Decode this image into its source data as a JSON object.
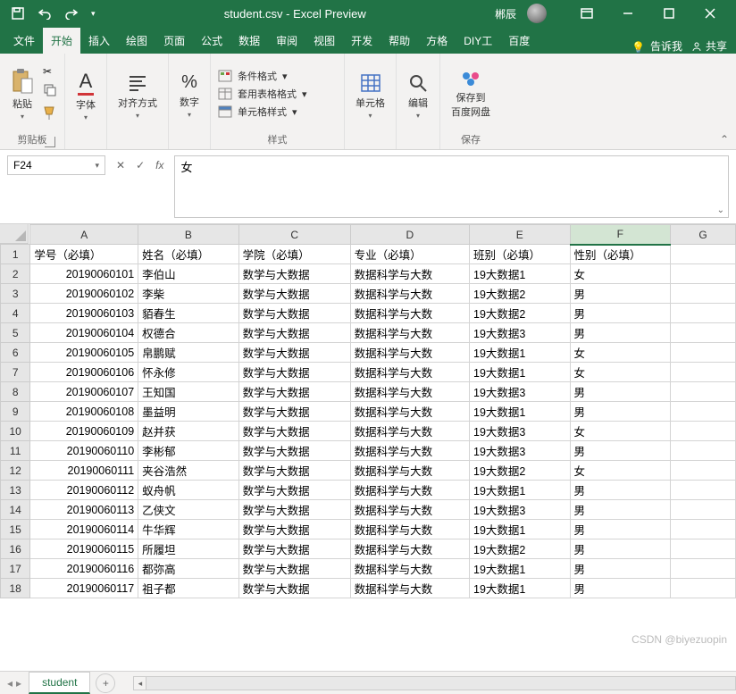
{
  "titlebar": {
    "filename": "student.csv",
    "app_suffix": " - Excel Preview",
    "username": "郴辰"
  },
  "tabs": {
    "file": "文件",
    "home": "开始",
    "insert": "插入",
    "draw": "绘图",
    "layout": "页面",
    "formulas": "公式",
    "data": "数据",
    "review": "审阅",
    "view": "视图",
    "dev": "开发",
    "help": "帮助",
    "fangge": "方格",
    "diy": "DIY工",
    "baidu": "百度",
    "tellme": "告诉我",
    "share": "共享"
  },
  "ribbon": {
    "clipboard": {
      "paste": "粘贴",
      "label": "剪贴板"
    },
    "font": {
      "btn": "字体",
      "label": "字体",
      "glyph": "A"
    },
    "align": {
      "btn": "对齐方式",
      "label": ""
    },
    "number": {
      "btn": "数字",
      "label": "",
      "glyph": "%"
    },
    "styles": {
      "cond": "条件格式",
      "table": "套用表格格式",
      "cell": "单元格样式",
      "label": "样式"
    },
    "cells": {
      "btn": "单元格"
    },
    "editing": {
      "btn": "编辑"
    },
    "save": {
      "btn": "保存到\n百度网盘",
      "label": "保存"
    }
  },
  "formula_bar": {
    "name_box": "F24",
    "value": "女"
  },
  "columns": [
    "A",
    "B",
    "C",
    "D",
    "E",
    "F",
    "G"
  ],
  "headers": {
    "A": "学号（必填）",
    "B": "姓名（必填）",
    "C": "学院（必填）",
    "D": "专业（必填）",
    "E": "班别（必填）",
    "F": "性别（必填）"
  },
  "rows": [
    {
      "id": "20190060101",
      "name": "李伯山",
      "college": "数学与大数据",
      "major": "数据科学与大数",
      "class_": "19大数据1",
      "gender": "女"
    },
    {
      "id": "20190060102",
      "name": "李柴",
      "college": "数学与大数据",
      "major": "数据科学与大数",
      "class_": "19大数据2",
      "gender": "男"
    },
    {
      "id": "20190060103",
      "name": "貊春生",
      "college": "数学与大数据",
      "major": "数据科学与大数",
      "class_": "19大数据2",
      "gender": "男"
    },
    {
      "id": "20190060104",
      "name": "权德合",
      "college": "数学与大数据",
      "major": "数据科学与大数",
      "class_": "19大数据3",
      "gender": "男"
    },
    {
      "id": "20190060105",
      "name": "帛鹏赋",
      "college": "数学与大数据",
      "major": "数据科学与大数",
      "class_": "19大数据1",
      "gender": "女"
    },
    {
      "id": "20190060106",
      "name": "怀永修",
      "college": "数学与大数据",
      "major": "数据科学与大数",
      "class_": "19大数据1",
      "gender": "女"
    },
    {
      "id": "20190060107",
      "name": "王知国",
      "college": "数学与大数据",
      "major": "数据科学与大数",
      "class_": "19大数据3",
      "gender": "男"
    },
    {
      "id": "20190060108",
      "name": "墨益明",
      "college": "数学与大数据",
      "major": "数据科学与大数",
      "class_": "19大数据1",
      "gender": "男"
    },
    {
      "id": "20190060109",
      "name": "赵并获",
      "college": "数学与大数据",
      "major": "数据科学与大数",
      "class_": "19大数据3",
      "gender": "女"
    },
    {
      "id": "20190060110",
      "name": "李彬郁",
      "college": "数学与大数据",
      "major": "数据科学与大数",
      "class_": "19大数据3",
      "gender": "男"
    },
    {
      "id": "20190060111",
      "name": "夹谷浩然",
      "college": "数学与大数据",
      "major": "数据科学与大数",
      "class_": "19大数据2",
      "gender": "女"
    },
    {
      "id": "20190060112",
      "name": "蚁舟帆",
      "college": "数学与大数据",
      "major": "数据科学与大数",
      "class_": "19大数据1",
      "gender": "男"
    },
    {
      "id": "20190060113",
      "name": "乙侠文",
      "college": "数学与大数据",
      "major": "数据科学与大数",
      "class_": "19大数据3",
      "gender": "男"
    },
    {
      "id": "20190060114",
      "name": "牛华辉",
      "college": "数学与大数据",
      "major": "数据科学与大数",
      "class_": "19大数据1",
      "gender": "男"
    },
    {
      "id": "20190060115",
      "name": "所履坦",
      "college": "数学与大数据",
      "major": "数据科学与大数",
      "class_": "19大数据2",
      "gender": "男"
    },
    {
      "id": "20190060116",
      "name": "都弥高",
      "college": "数学与大数据",
      "major": "数据科学与大数",
      "class_": "19大数据1",
      "gender": "男"
    },
    {
      "id": "20190060117",
      "name": "祖子都",
      "college": "数学与大数据",
      "major": "数据科学与大数",
      "class_": "19大数据1",
      "gender": "男"
    }
  ],
  "sheet_tab": "student",
  "watermark": "CSDN @biyezuopin"
}
